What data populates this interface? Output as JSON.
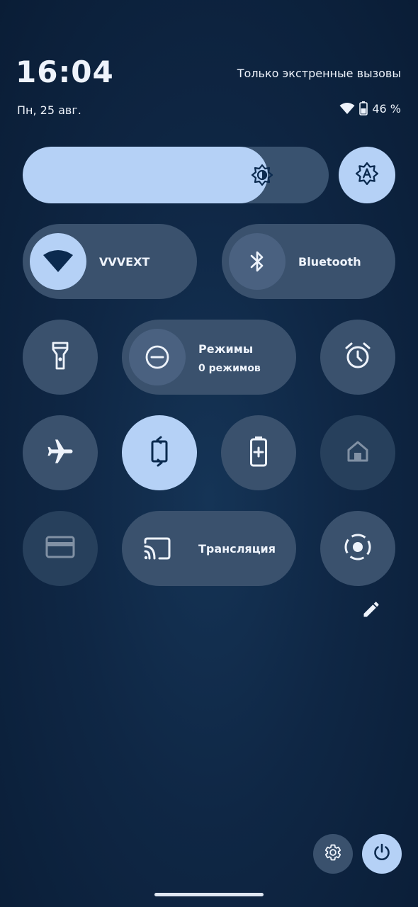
{
  "header": {
    "time": "16:04",
    "network_status": "Только экстренные вызовы",
    "date": "Пн, 25 авг.",
    "battery_percent": "46 %"
  },
  "brightness": {
    "level": 0.8,
    "icon": "brightness-icon",
    "auto_icon": "auto-brightness-icon"
  },
  "tiles": {
    "wifi": {
      "label": "VVVEXT",
      "active": true,
      "icon": "wifi-icon"
    },
    "bluetooth": {
      "label": "Bluetooth",
      "active": false,
      "icon": "bluetooth-icon"
    },
    "flashlight": {
      "active": false,
      "icon": "flashlight-icon"
    },
    "modes": {
      "label": "Режимы",
      "sublabel": "0 режимов",
      "active": false,
      "icon": "do-not-disturb-icon"
    },
    "alarm": {
      "active": false,
      "icon": "alarm-icon"
    },
    "airplane": {
      "active": false,
      "icon": "airplane-icon"
    },
    "autorotate": {
      "active": true,
      "icon": "rotate-icon"
    },
    "battery_saver": {
      "active": false,
      "icon": "battery-saver-icon"
    },
    "home": {
      "active": false,
      "disabled": true,
      "icon": "home-icon"
    },
    "wallet": {
      "active": false,
      "disabled": true,
      "icon": "card-icon"
    },
    "cast": {
      "label": "Трансляция",
      "active": false,
      "icon": "cast-icon"
    },
    "screen_record": {
      "active": false,
      "icon": "screen-record-icon"
    }
  },
  "colors": {
    "background": "#0f2745",
    "tile": "#3a516d",
    "tile_active": "#b5d1f6",
    "icon_dark": "#0b2a4f",
    "text": "#eef3fb"
  }
}
